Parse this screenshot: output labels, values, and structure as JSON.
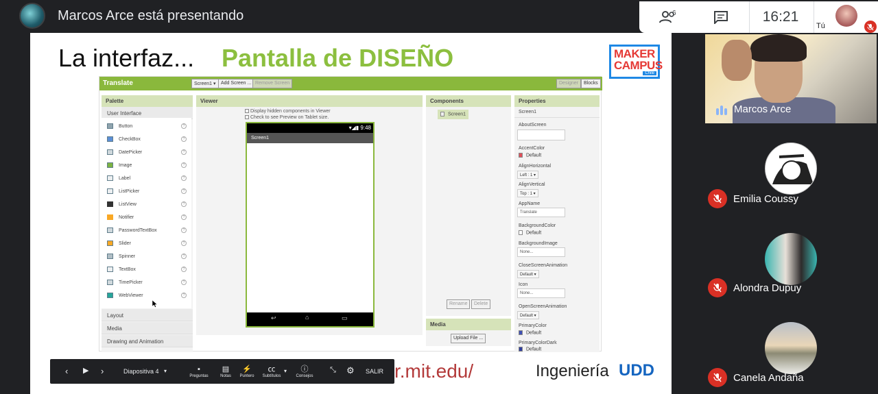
{
  "topbar": {
    "presenter_title": "Marcos Arce está presentando",
    "participants_badge": "6",
    "clock": "16:21",
    "self_label": "Tú"
  },
  "slide": {
    "title": "La interfaz...",
    "subtitle": "Pantalla de DISEÑO",
    "maker_logo": "MAKER CAMPUS",
    "maker_logo_sub": "Chile",
    "url": "r.mit.edu/",
    "footer_brand": "Ingeniería",
    "footer_brand_logo": "UDD"
  },
  "app_inventor": {
    "project": "Translate",
    "buttons": [
      "Screen1 ▾",
      "Add Screen ...",
      "Remove Screen",
      "Designer",
      "Blocks"
    ],
    "palette": {
      "header": "Palette",
      "section": "User Interface",
      "items": [
        "Button",
        "CheckBox",
        "DatePicker",
        "Image",
        "Label",
        "ListPicker",
        "ListView",
        "Notifier",
        "PasswordTextBox",
        "Slider",
        "Spinner",
        "TextBox",
        "TimePicker",
        "WebViewer"
      ],
      "other_sections": [
        "Layout",
        "Media",
        "Drawing and Animation"
      ]
    },
    "viewer": {
      "header": "Viewer",
      "checkbox1": "Display hidden components in Viewer",
      "checkbox2": "Check to see Preview on Tablet size.",
      "phone_time": "9:48",
      "screen_title": "Screen1"
    },
    "components": {
      "header": "Components",
      "tree_item": "Screen1",
      "rename": "Rename",
      "delete": "Delete",
      "media_header": "Media",
      "upload": "Upload File ..."
    },
    "properties": {
      "header": "Properties",
      "screen": "Screen1",
      "about_screen": "AboutScreen",
      "accent_color": "AccentColor",
      "accent_value": "Default",
      "align_h": "AlignHorizontal",
      "align_h_value": "Left : 1 ▾",
      "align_v": "AlignVertical",
      "align_v_value": "Top : 1 ▾",
      "app_name": "AppName",
      "app_name_value": "Translate",
      "bg_color": "BackgroundColor",
      "bg_color_value": "Default",
      "bg_image": "BackgroundImage",
      "bg_image_value": "None...",
      "close_anim": "CloseScreenAnimation",
      "close_anim_value": "Default ▾",
      "icon": "Icon",
      "icon_value": "None...",
      "open_anim": "OpenScreenAnimation",
      "open_anim_value": "Default ▾",
      "primary_color": "PrimaryColor",
      "primary_color_value": "Default",
      "primary_dark": "PrimaryColorDark",
      "primary_dark_value": "Default"
    }
  },
  "presentation_bar": {
    "slide_label": "Diapositiva 4",
    "items": [
      "Preguntas",
      "Notas",
      "Puntero",
      "Subtítulos",
      "Consejos"
    ],
    "exit": "SALIR"
  },
  "participants": [
    {
      "name": "Marcos Arce"
    },
    {
      "name": "Emilia Coussy"
    },
    {
      "name": "Alondra Dupuy"
    },
    {
      "name": "Canela Andaña"
    }
  ],
  "colors": {
    "app_green": "#8ab83c",
    "muted_red": "#d93025",
    "accent_pink": "#e0505a",
    "primary_blue": "#3f51b5"
  }
}
